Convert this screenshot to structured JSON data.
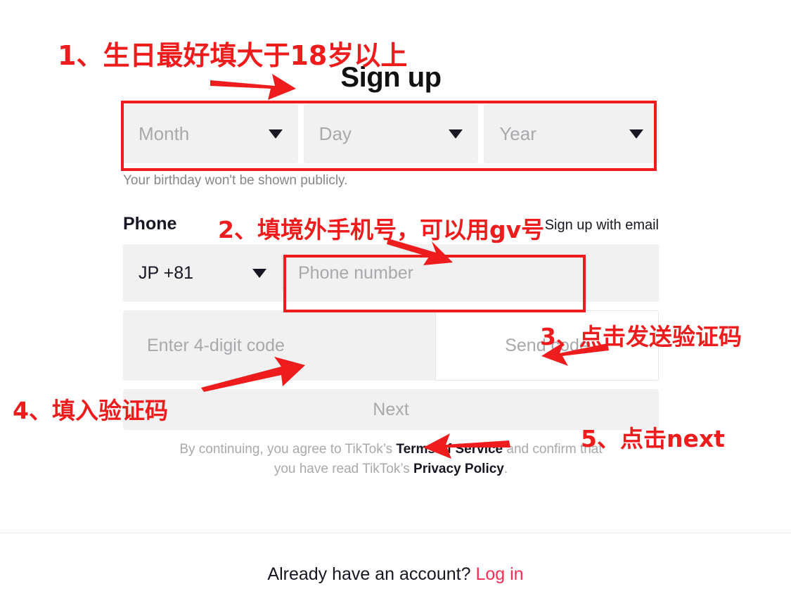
{
  "page": {
    "title": "Sign up",
    "background": "#ffffff",
    "accent_red": "#ee1c1c",
    "brand_pink": "#fe2c55"
  },
  "birthday": {
    "fields": [
      {
        "name": "month",
        "placeholder": "Month",
        "value": "",
        "caret": "chevron-down-icon"
      },
      {
        "name": "day",
        "placeholder": "Day",
        "value": "",
        "caret": "chevron-down-icon"
      },
      {
        "name": "year",
        "placeholder": "Year",
        "value": "",
        "caret": "chevron-down-icon"
      }
    ],
    "hint": "Your birthday won't be shown publicly."
  },
  "phone": {
    "label": "Phone",
    "email_link": "Sign up with email",
    "country_code": "JP +81",
    "number_placeholder": "Phone number",
    "number_value": ""
  },
  "code": {
    "placeholder": "Enter 4-digit code",
    "value": "",
    "send_button": "Send code"
  },
  "next": {
    "label": "Next"
  },
  "terms": {
    "line1_pre": "By continuing, you agree to TikTok’s ",
    "line1_bold": "Terms of Service",
    "line1_post": " and confirm that",
    "line2_pre": "you have read TikTok’s ",
    "line2_bold": "Privacy Policy",
    "line2_post": "."
  },
  "footer": {
    "prompt": "Already have an account?",
    "login_label": "Log in"
  },
  "annotations": [
    {
      "id": 1,
      "text": "1、生日最好填大于18岁以上"
    },
    {
      "id": 2,
      "text": "2、填境外手机号，可以用gv号"
    },
    {
      "id": 3,
      "text": "3、点击发送验证码"
    },
    {
      "id": 4,
      "text": "4、填入验证码"
    },
    {
      "id": 5,
      "text": "5、点击next"
    }
  ]
}
